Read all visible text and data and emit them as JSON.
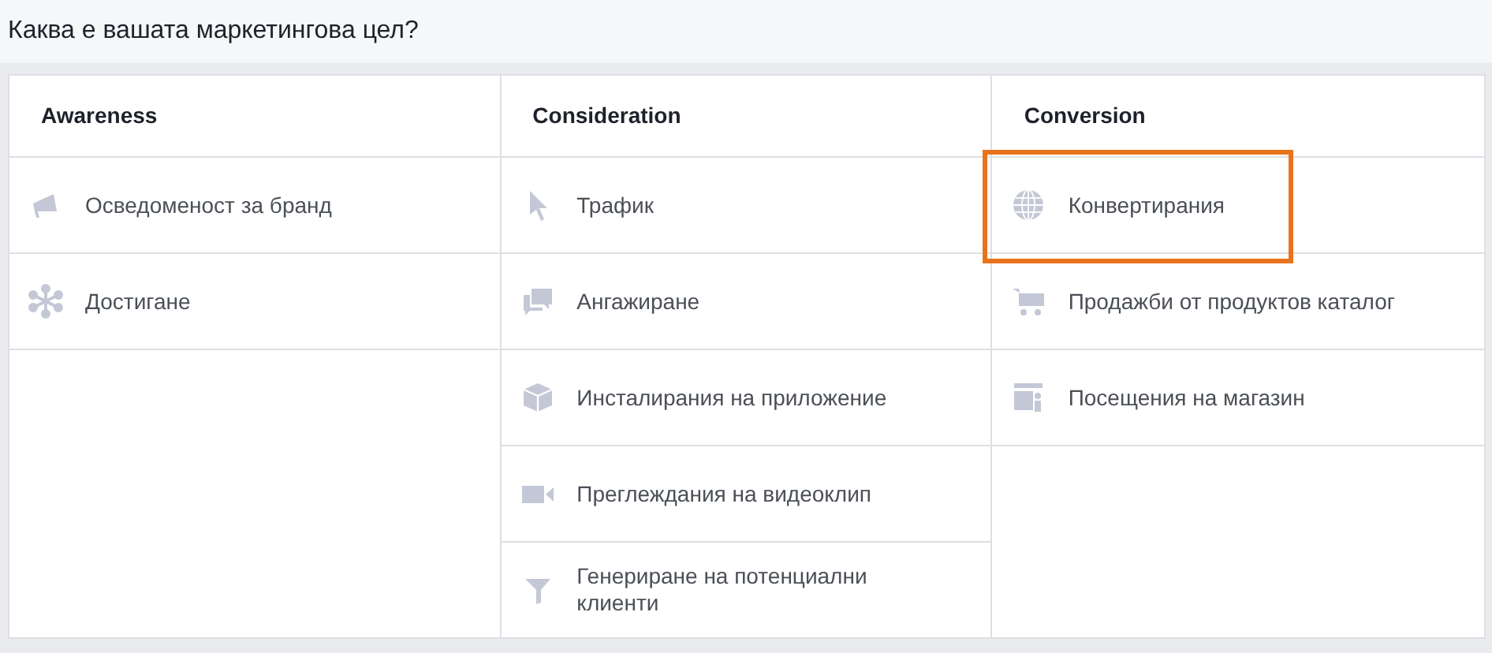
{
  "question": "Каква е вашата маркетингова цел?",
  "columns": [
    {
      "title": "Awareness",
      "items": [
        {
          "label": "Осведоменост за бранд",
          "highlighted": false
        },
        {
          "label": "Достигане",
          "highlighted": false
        }
      ]
    },
    {
      "title": "Consideration",
      "items": [
        {
          "label": "Трафик",
          "highlighted": false
        },
        {
          "label": "Ангажиране",
          "highlighted": false
        },
        {
          "label": "Инсталирания на приложение",
          "highlighted": false
        },
        {
          "label": "Преглеждания на видеоклип",
          "highlighted": false
        },
        {
          "label": "Генериране на потенциални клиенти",
          "highlighted": false
        }
      ]
    },
    {
      "title": "Conversion",
      "items": [
        {
          "label": "Конвертирания",
          "highlighted": true
        },
        {
          "label": "Продажби от продуктов каталог",
          "highlighted": false
        },
        {
          "label": "Посещения на магазин",
          "highlighted": false
        }
      ]
    }
  ]
}
